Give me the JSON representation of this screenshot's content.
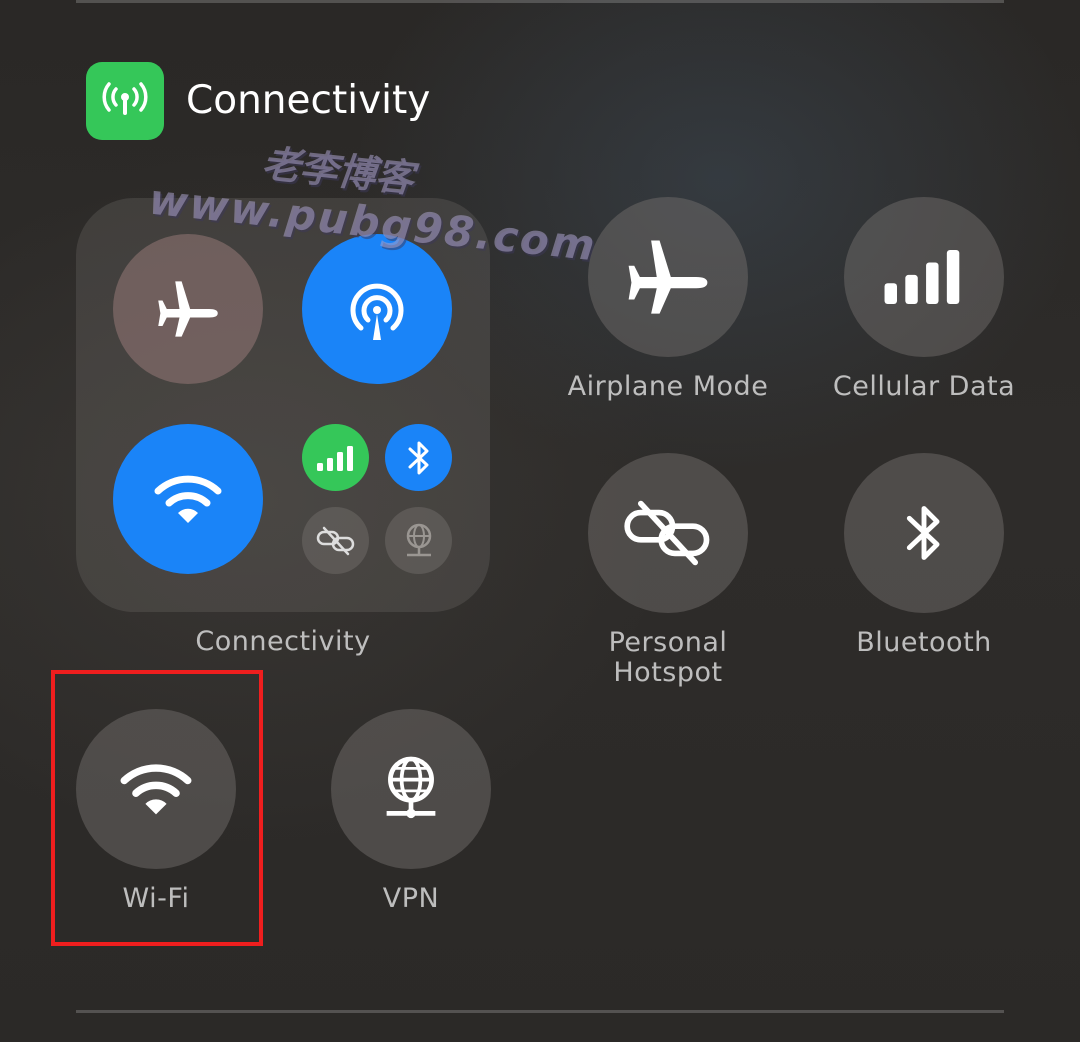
{
  "header": {
    "title": "Connectivity",
    "icon": "antenna-icon",
    "icon_color": "#35c759"
  },
  "watermark": {
    "line1": "老李博客",
    "line2": "www.pubg98.com"
  },
  "module": {
    "label": "Connectivity",
    "tiles": [
      {
        "name": "airplane-mode",
        "icon": "airplane-icon",
        "state": "off"
      },
      {
        "name": "airdrop",
        "icon": "airdrop-icon",
        "state": "on",
        "color": "#1a84f8"
      },
      {
        "name": "wifi",
        "icon": "wifi-icon",
        "state": "on",
        "color": "#1a84f8"
      },
      {
        "name": "cellular-data",
        "icon": "cellular-bars-icon",
        "state": "on",
        "color": "#35c759"
      },
      {
        "name": "bluetooth",
        "icon": "bluetooth-icon",
        "state": "on",
        "color": "#1a84f8"
      },
      {
        "name": "personal-hotspot",
        "icon": "hotspot-link-icon",
        "state": "off"
      },
      {
        "name": "vpn",
        "icon": "vpn-globe-icon",
        "state": "off"
      }
    ]
  },
  "controls": {
    "airplane_mode": "Airplane Mode",
    "cellular_data": "Cellular Data",
    "personal_hotspot_line1": "Personal",
    "personal_hotspot_line2": "Hotspot",
    "bluetooth": "Bluetooth",
    "wifi": "Wi-Fi",
    "vpn": "VPN"
  },
  "colors": {
    "highlight_border": "#ef1e1e",
    "accent_blue": "#1a84f8",
    "accent_green": "#35c759"
  }
}
